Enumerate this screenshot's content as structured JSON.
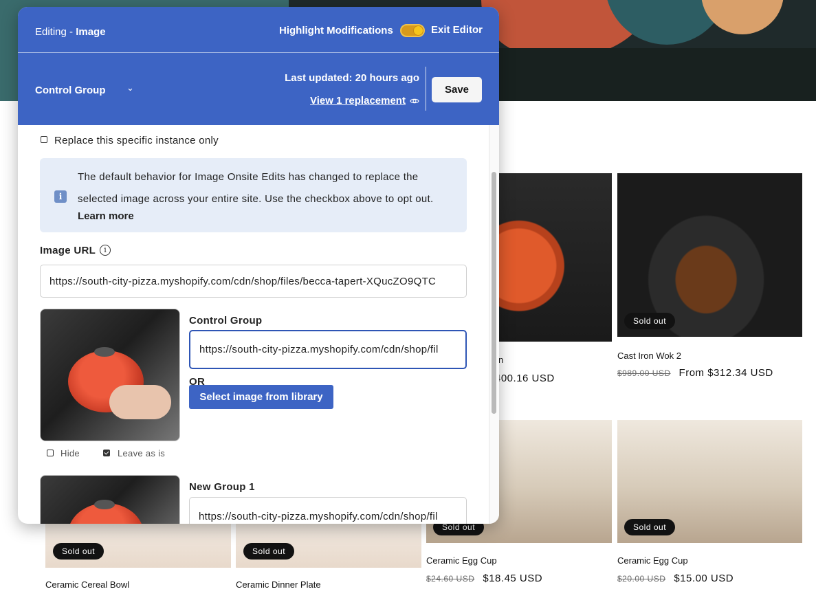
{
  "editor": {
    "title_prefix": "Editing - ",
    "title_type": "Image",
    "highlight_label": "Highlight Modifications",
    "highlight_on": true,
    "exit_label": "Exit Editor",
    "group_select": "Control Group",
    "last_updated": "Last updated: 20 hours ago",
    "view_replacement": "View 1 replacement",
    "save_label": "Save",
    "replace_instance_label": "Replace this specific instance only",
    "replace_instance_checked": false,
    "info_text": "The default behavior for Image Onsite Edits has changed to replace the selected image across your entire site. Use the checkbox above to opt out.",
    "learn_more": "Learn more",
    "image_url_label": "Image URL",
    "image_url_value": "https://south-city-pizza.myshopify.com/cdn/shop/files/becca-tapert-XQucZO9QTC",
    "groups": [
      {
        "name": "Control Group",
        "url": "https://south-city-pizza.myshopify.com/cdn/shop/fil",
        "or_label": "OR",
        "library_button": "Select image from library",
        "hide_label": "Hide",
        "hide_checked": false,
        "leave_label": "Leave as is",
        "leave_checked": true
      },
      {
        "name": "New Group 1",
        "url": "https://south-city-pizza.myshopify.com/cdn/shop/fil"
      }
    ]
  },
  "store": {
    "products": [
      {
        "title": "",
        "partial_title": "n",
        "price_partial": "400.16 USD"
      },
      {
        "title": "Cast Iron Wok 2",
        "badge": "Sold out",
        "compare_price": "$989.00 USD",
        "price": "From $312.34 USD"
      },
      {
        "title": "Ceramic Egg Cup",
        "badge": "Sold out",
        "compare_price": "$24.60 USD",
        "price": "$18.45 USD"
      },
      {
        "title": "Ceramic Egg Cup",
        "badge": "Sold out",
        "compare_price": "$20.00 USD",
        "price": "$15.00 USD"
      },
      {
        "title": "Ceramic Cereal Bowl",
        "badge": "Sold out"
      },
      {
        "title": "Ceramic Dinner Plate",
        "badge": "Sold out"
      }
    ]
  },
  "colors": {
    "panel_header": "#3d64c4",
    "toggle": "#f7c51c",
    "info_bg": "#e6edf8",
    "focus_border": "#2e55b5"
  }
}
